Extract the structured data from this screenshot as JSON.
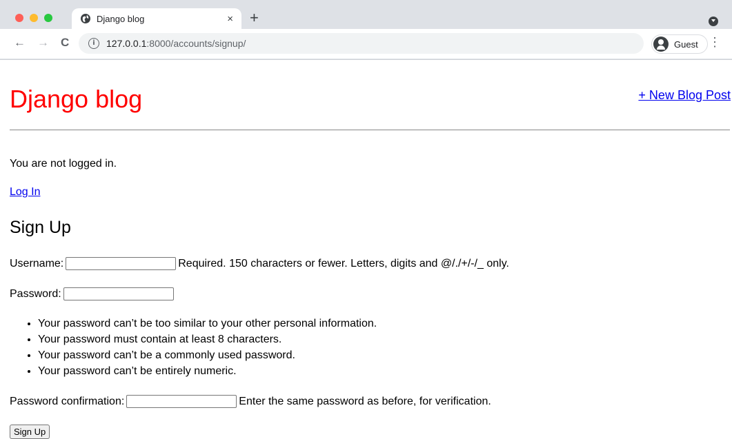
{
  "browser": {
    "tab_title": "Django blog",
    "tab_close": "×",
    "new_tab": "+",
    "url_host": "127.0.0.1",
    "url_rest": ":8000/accounts/signup/",
    "profile_label": "Guest",
    "back": "←",
    "forward": "→",
    "reload": "C",
    "menu": "⋮",
    "info": "i"
  },
  "site": {
    "title": "Django blog",
    "new_post_link": "+ New Blog Post"
  },
  "auth": {
    "status_text": "You are not logged in.",
    "login_link": "Log In"
  },
  "signup": {
    "heading": "Sign Up",
    "username_label": "Username:",
    "username_value": "",
    "username_help": "Required. 150 characters or fewer. Letters, digits and @/./+/-/_ only.",
    "password_label": "Password:",
    "password_value": "",
    "password_rules": [
      "Your password can’t be too similar to your other personal information.",
      "Your password must contain at least 8 characters.",
      "Your password can’t be a commonly used password.",
      "Your password can’t be entirely numeric."
    ],
    "confirm_label": "Password confirmation:",
    "confirm_value": "",
    "confirm_help": "Enter the same password as before, for verification.",
    "submit_label": "Sign Up"
  },
  "colors": {
    "title": "#ff0000",
    "link": "#0000ee",
    "chrome_bg": "#dee1e6"
  },
  "icons": {
    "favicon": "globe-icon",
    "info": "info-icon",
    "avatar": "guest-avatar-icon",
    "menu": "kebab-menu-icon"
  }
}
